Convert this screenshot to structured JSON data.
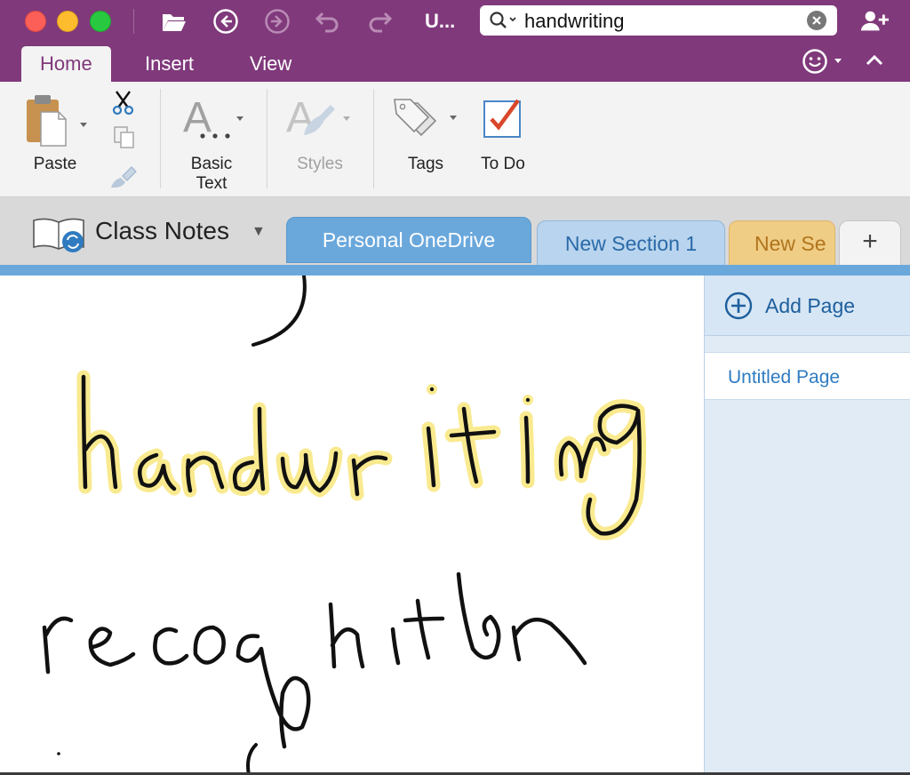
{
  "window": {
    "title": "U...",
    "search": {
      "value": "handwriting"
    }
  },
  "titlebar_icons": [
    "folder-open-icon",
    "back-icon",
    "forward-icon",
    "undo-icon",
    "redo-icon",
    "add-person-icon"
  ],
  "tabs": [
    {
      "label": "Home",
      "active": true
    },
    {
      "label": "Insert",
      "active": false
    },
    {
      "label": "View",
      "active": false
    }
  ],
  "ribbon": {
    "paste_label": "Paste",
    "basic_text_line1": "Basic",
    "basic_text_line2": "Text",
    "styles_label": "Styles",
    "tags_label": "Tags",
    "todo_label": "To Do"
  },
  "notebook": {
    "name": "Class Notes",
    "sections": [
      {
        "label": "Personal OneDrive",
        "active": true,
        "color": "#6aa8dc"
      },
      {
        "label": "New Section 1",
        "active": false,
        "color": "#b9d4ee"
      },
      {
        "label": "New Se",
        "active": false,
        "color": "#f0cd85"
      }
    ],
    "add_section_label": "+"
  },
  "pages": {
    "add_label": "Add Page",
    "items": [
      {
        "label": "Untitled Page"
      }
    ]
  },
  "ink": {
    "highlight_color": "#f9ea8f",
    "ink_color": "#111111"
  },
  "colors": {
    "brand": "#80397b",
    "section_active": "#6aa8dc"
  }
}
